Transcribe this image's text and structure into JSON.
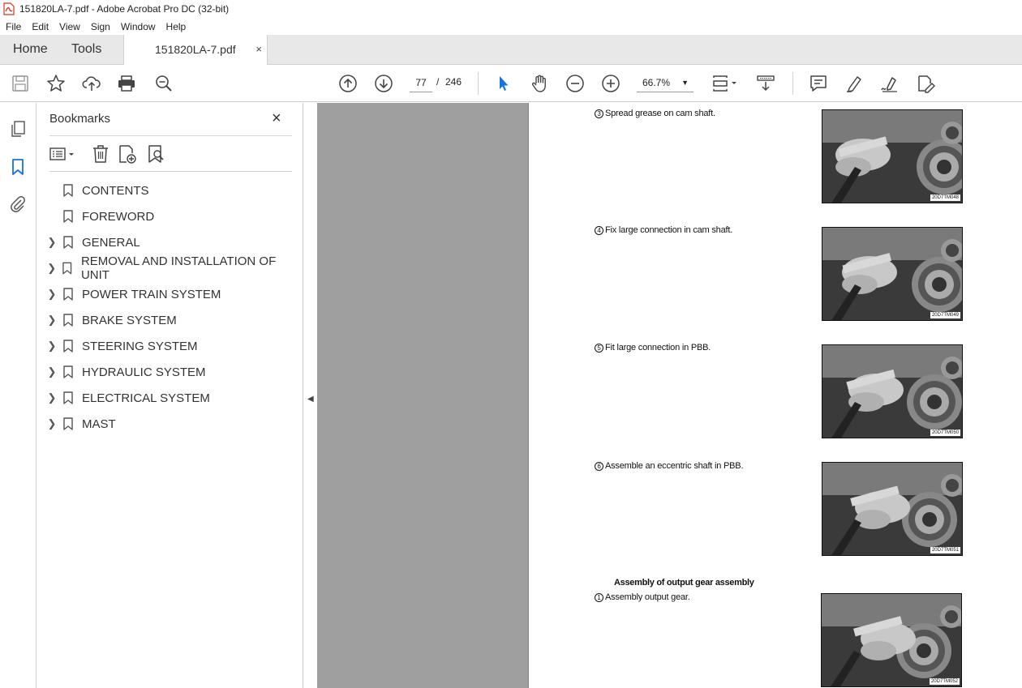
{
  "window": {
    "title": "151820LA-7.pdf - Adobe Acrobat Pro DC (32-bit)"
  },
  "menu": [
    "File",
    "Edit",
    "View",
    "Sign",
    "Window",
    "Help"
  ],
  "tabs": {
    "home": "Home",
    "tools": "Tools",
    "document": "151820LA-7.pdf",
    "close_glyph": "×"
  },
  "toolbar": {
    "current_page": "77",
    "page_separator": "/",
    "total_pages": "246",
    "zoom": "66.7%",
    "icons": [
      "save-icon",
      "star-icon",
      "upload-icon",
      "print-icon",
      "search-zoom-icon",
      "prev-page-icon",
      "next-page-icon",
      "select-arrow-icon",
      "hand-icon",
      "zoom-out-icon",
      "zoom-in-icon",
      "fit-page-icon",
      "scroll-mode-icon",
      "comment-icon",
      "highlight-icon",
      "sign-icon",
      "edit-pdf-icon"
    ]
  },
  "bookmarks": {
    "title": "Bookmarks",
    "close_glyph": "×",
    "items": [
      {
        "label": "CONTENTS",
        "expandable": false
      },
      {
        "label": "FOREWORD",
        "expandable": false
      },
      {
        "label": "GENERAL",
        "expandable": true
      },
      {
        "label": "REMOVAL AND INSTALLATION OF UNIT",
        "expandable": true
      },
      {
        "label": "POWER TRAIN SYSTEM",
        "expandable": true
      },
      {
        "label": "BRAKE SYSTEM",
        "expandable": true
      },
      {
        "label": "STEERING SYSTEM",
        "expandable": true
      },
      {
        "label": "HYDRAULIC SYSTEM",
        "expandable": true
      },
      {
        "label": "ELECTRICAL SYSTEM",
        "expandable": true
      },
      {
        "label": "MAST",
        "expandable": true
      }
    ]
  },
  "page": {
    "steps": [
      {
        "num": "3",
        "text": "Spread grease on cam shaft.",
        "photo_code": "20D7TM048"
      },
      {
        "num": "4",
        "text": "Fix large connection in cam shaft.",
        "photo_code": "20D7TM049"
      },
      {
        "num": "5",
        "text": "Fit large connection in PBB.",
        "photo_code": "20D7TM050"
      },
      {
        "num": "6",
        "text": "Assemble an eccentric shaft in PBB.",
        "photo_code": "20D7TM051"
      }
    ],
    "section_heading": "Assembly of output gear assembly",
    "section_step": {
      "num": "1",
      "text": "Assembly output gear.",
      "photo_code": "20D7TM052"
    }
  },
  "colors": {
    "accent": "#1473e6",
    "doc_background": "#9f9f9f",
    "tab_bar": "#e8e8e8"
  }
}
